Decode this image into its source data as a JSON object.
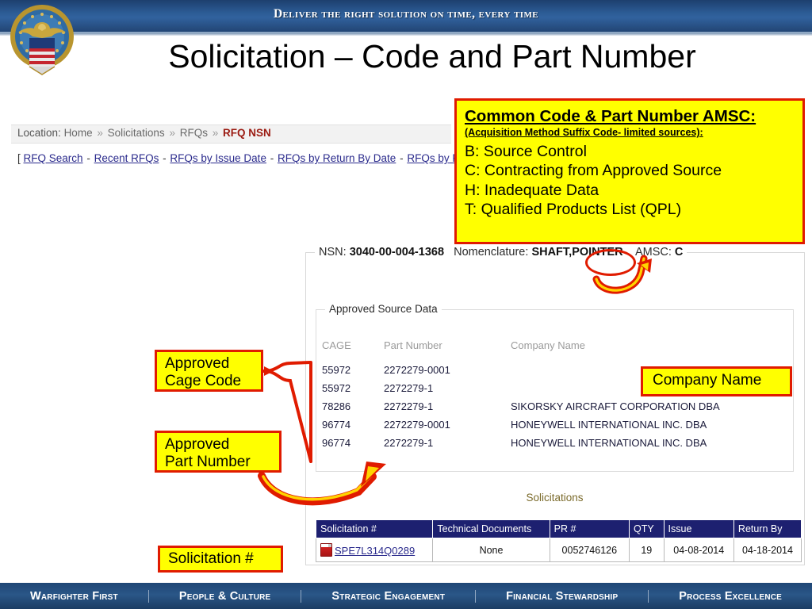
{
  "banner": {
    "tagline": "Deliver the right solution on time, every time",
    "logo_name": "dla-seal"
  },
  "slide": {
    "title": "Solicitation – Code and Part Number"
  },
  "breadcrumb": {
    "label": "Location:",
    "items": [
      "Home",
      "Solicitations",
      "RFQs"
    ],
    "current": "RFQ NSN",
    "separator": "»"
  },
  "nav_links": {
    "open_bracket": "[",
    "close_bracket": "]",
    "dash": "-",
    "items": [
      "RFQ Search",
      "Recent RFQs",
      "RFQs by Issue Date",
      "RFQs by Return By Date",
      "RFQs by FSC"
    ]
  },
  "rfq_panel": {
    "nsn_label": "NSN:",
    "nsn_value": "3040-00-004-1368",
    "nomenclature_label": "Nomenclature:",
    "nomenclature_value": "SHAFT,POINTER",
    "amsc_label": "AMSC:",
    "amsc_value": "C",
    "approved_source_legend": "Approved Source Data",
    "columns": [
      "CAGE",
      "Part Number",
      "Company Name"
    ],
    "rows": [
      {
        "cage": "55972",
        "part_number": "2272279-0001",
        "company": ""
      },
      {
        "cage": "55972",
        "part_number": "2272279-1",
        "company": ""
      },
      {
        "cage": "78286",
        "part_number": "2272279-1",
        "company": "SIKORSKY AIRCRAFT CORPORATION DBA"
      },
      {
        "cage": "96774",
        "part_number": "2272279-0001",
        "company": "HONEYWELL INTERNATIONAL INC. DBA"
      },
      {
        "cage": "96774",
        "part_number": "2272279-1",
        "company": "HONEYWELL INTERNATIONAL INC. DBA"
      }
    ]
  },
  "solicitations": {
    "caption": "Solicitations",
    "columns": [
      "Solicitation #",
      "Technical Documents",
      "PR #",
      "QTY",
      "Issue",
      "Return By"
    ],
    "rows": [
      {
        "solicitation": "SPE7L314Q0289",
        "icon": "pdf-icon",
        "technical_documents": "None",
        "pr_number": "0052746126",
        "qty": "19",
        "issue": "04-08-2014",
        "return_by": "04-18-2014"
      }
    ]
  },
  "callouts": {
    "amsc": {
      "title": "Common Code & Part Number AMSC:",
      "subtitle": "(Acquisition Method Suffix Code- limited sources):",
      "lines": [
        "B: Source Control",
        "C: Contracting from Approved Source",
        "H: Inadequate Data",
        "T: Qualified Products List (QPL)"
      ]
    },
    "cage": {
      "line1": "Approved",
      "line2": "Cage Code"
    },
    "part": {
      "line1": "Approved",
      "line2": "Part Number"
    },
    "solicitation_number": "Solicitation #",
    "company_name": "Company Name"
  },
  "footer": {
    "segments": [
      "Warfighter First",
      "People & Culture",
      "Strategic Engagement",
      "Financial Stewardship",
      "Process Excellence"
    ]
  },
  "colors": {
    "banner_blue": "#2b5a93",
    "callout_yellow": "#ffff00",
    "callout_border_red": "#e01b00",
    "table_header_navy": "#1d2070",
    "link_blue": "#2a2a8c",
    "breadcrumb_current_red": "#9b1b12"
  }
}
